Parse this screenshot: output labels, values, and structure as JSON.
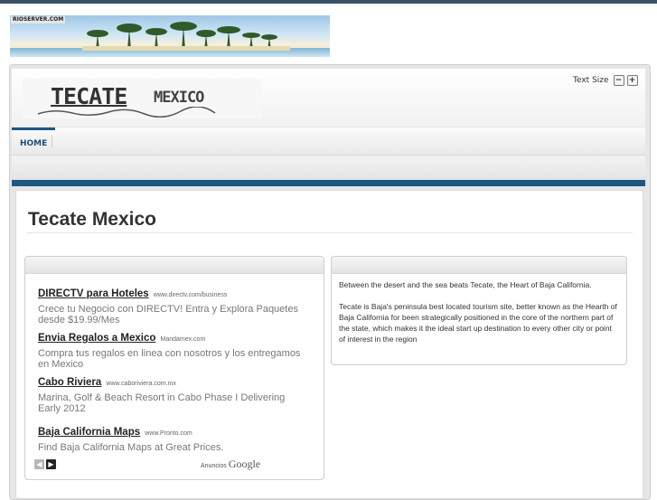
{
  "banner": {
    "label": "RIOSERVER.COM"
  },
  "logo": {
    "main": "TECATE",
    "sub": "MEXICO"
  },
  "text_size": {
    "label": "Text Size",
    "decrease": "−",
    "increase": "+"
  },
  "nav": {
    "items": [
      {
        "label": "HOME"
      }
    ]
  },
  "page": {
    "title": "Tecate Mexico"
  },
  "ads": [
    {
      "title": "DIRECTV para Hoteles",
      "url": "www.directv.com/business",
      "desc": "Crece tu Negocio con DIRECTV! Entra y Explora Paquetes desde $19.99/Mes"
    },
    {
      "title": "Envia Regalos a Mexico",
      "url": "Mandamex.com",
      "desc": "Compra tus regalos en linea con nosotros y los entregamos en Mexico"
    },
    {
      "title": "Cabo Riviera",
      "url": "www.caboriviera.com.mx",
      "desc": "Marina, Golf & Beach Resort in Cabo Phase I Delivering Early 2012"
    },
    {
      "title": "Baja California Maps",
      "url": "www.Pronto.com",
      "desc": "Find Baja California Maps at Great Prices."
    }
  ],
  "ad_footer": {
    "prev": "◀",
    "next": "▶",
    "label": "Anuncios",
    "brand": "Google"
  },
  "intro": {
    "p1": "Between the desert and the sea beats Tecate, the Heart of Baja California.",
    "p2": "Tecate is Baja's peninsula best located tourism site, better known as the Hearth of Baja California for been strategically positioned in the core of the northern part of the state, which makes it the ideal start up destination to every other city or point of interest in the region"
  },
  "colors": {
    "accent": "#1d5782",
    "topbar": "#3a5268"
  },
  "icons": [
    "decrease-text-icon",
    "increase-text-icon",
    "prev-arrow-icon",
    "next-arrow-icon"
  ]
}
